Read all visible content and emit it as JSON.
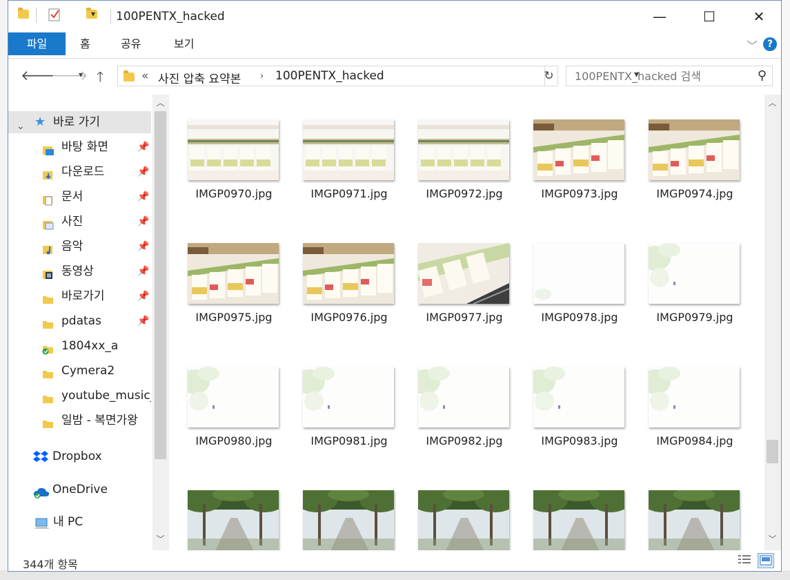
{
  "window": {
    "title": "100PENTX_hacked",
    "minimize_glyph": "—",
    "maximize_glyph": "☐",
    "close_glyph": "✕"
  },
  "ribbon": {
    "tabs": [
      "파일",
      "홈",
      "공유",
      "보기"
    ],
    "help_label": "?"
  },
  "address": {
    "prefix": "«",
    "crumbs": [
      "사진 압축 요약본",
      "100PENTX_hacked"
    ]
  },
  "search": {
    "placeholder": "100PENTX_hacked 검색"
  },
  "nav": {
    "quick_access": "바로 가기",
    "items": [
      {
        "label": "바탕 화면",
        "icon": "desktop-folder-icon",
        "pinned": true
      },
      {
        "label": "다운로드",
        "icon": "downloads-folder-icon",
        "pinned": true
      },
      {
        "label": "문서",
        "icon": "documents-folder-icon",
        "pinned": true
      },
      {
        "label": "사진",
        "icon": "pictures-folder-icon",
        "pinned": true
      },
      {
        "label": "음악",
        "icon": "music-folder-icon",
        "pinned": true
      },
      {
        "label": "동영상",
        "icon": "videos-folder-icon",
        "pinned": true
      },
      {
        "label": "바로가기",
        "icon": "folder-icon",
        "pinned": true
      },
      {
        "label": "pdatas",
        "icon": "folder-icon",
        "pinned": true
      },
      {
        "label": "1804xx_a",
        "icon": "synced-folder-icon",
        "pinned": false
      },
      {
        "label": "Cymera2",
        "icon": "folder-icon",
        "pinned": false
      },
      {
        "label": "youtube_music_",
        "icon": "folder-icon",
        "pinned": false
      },
      {
        "label": "일밤 - 복면가왕",
        "icon": "folder-icon",
        "pinned": false
      }
    ],
    "dropbox": "Dropbox",
    "onedrive": "OneDrive",
    "thispc": "내 PC"
  },
  "files": [
    {
      "name": "IMGP0970.jpg",
      "scene": "shelf-light"
    },
    {
      "name": "IMGP0971.jpg",
      "scene": "shelf-light"
    },
    {
      "name": "IMGP0972.jpg",
      "scene": "shelf-light"
    },
    {
      "name": "IMGP0973.jpg",
      "scene": "shelf-dark"
    },
    {
      "name": "IMGP0974.jpg",
      "scene": "shelf-dark"
    },
    {
      "name": "IMGP0975.jpg",
      "scene": "shelf-dark"
    },
    {
      "name": "IMGP0976.jpg",
      "scene": "shelf-dark"
    },
    {
      "name": "IMGP0977.jpg",
      "scene": "shelf-tilt"
    },
    {
      "name": "IMGP0978.jpg",
      "scene": "white"
    },
    {
      "name": "IMGP0979.jpg",
      "scene": "trees-faint"
    },
    {
      "name": "IMGP0980.jpg",
      "scene": "trees-faint"
    },
    {
      "name": "IMGP0981.jpg",
      "scene": "trees-faint"
    },
    {
      "name": "IMGP0982.jpg",
      "scene": "trees-faint"
    },
    {
      "name": "IMGP0983.jpg",
      "scene": "trees-faint"
    },
    {
      "name": "IMGP0984.jpg",
      "scene": "trees-faint"
    },
    {
      "name": "",
      "scene": "road"
    },
    {
      "name": "",
      "scene": "road"
    },
    {
      "name": "",
      "scene": "road"
    },
    {
      "name": "",
      "scene": "road"
    },
    {
      "name": "",
      "scene": "road"
    }
  ],
  "status": {
    "count": "344개 항목"
  },
  "colors": {
    "accent": "#1979ca",
    "folder": "#f2c94c",
    "selection": "#e5e5e5"
  }
}
